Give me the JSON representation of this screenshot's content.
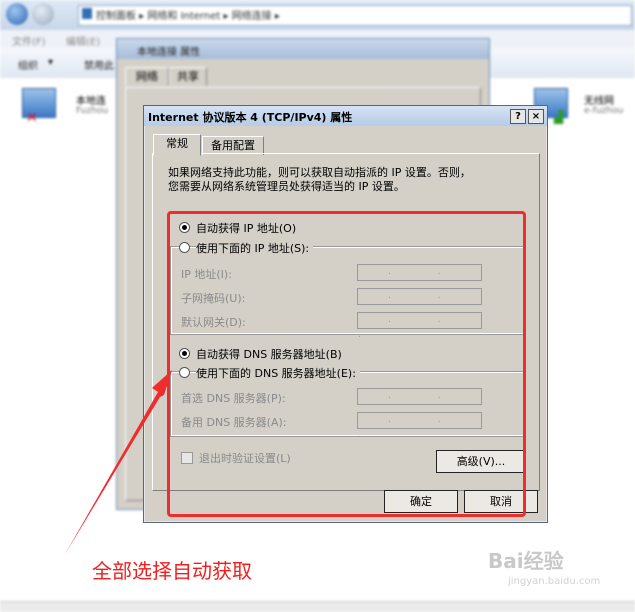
{
  "explorer": {
    "breadcrumb": [
      "控制面板",
      "网络和 Internet",
      "网络连接"
    ],
    "menu": [
      "文件(F)",
      "编辑(E)"
    ],
    "toolbar": [
      "组织",
      "禁用此"
    ],
    "connections": [
      {
        "name": "本地连",
        "detail": "Fuzhou"
      },
      {
        "name": "无线网",
        "detail": "e-fuzhou"
      }
    ]
  },
  "properties_window": {
    "title": "本地连接 属性",
    "tabs": [
      "网络",
      "共享"
    ]
  },
  "dialog": {
    "title": "Internet 协议版本 4 (TCP/IPv4) 属性",
    "help_label": "?",
    "close_label": "×",
    "tabs": [
      "常规",
      "备用配置"
    ],
    "intro_line1": "如果网络支持此功能，则可以获取自动指派的 IP 设置。否则，",
    "intro_line2": "您需要从网络系统管理员处获得适当的 IP 设置。",
    "ip": {
      "auto_label": "自动获得 IP 地址(O)",
      "auto_selected": true,
      "manual_label": "使用下面的 IP 地址(S):",
      "fields": [
        {
          "label": "IP 地址(I):",
          "value": ". . ."
        },
        {
          "label": "子网掩码(U):",
          "value": ". . ."
        },
        {
          "label": "默认网关(D):",
          "value": ". . ."
        }
      ]
    },
    "dns": {
      "auto_label": "自动获得 DNS 服务器地址(B)",
      "auto_selected": true,
      "manual_label": "使用下面的 DNS 服务器地址(E):",
      "fields": [
        {
          "label": "首选 DNS 服务器(P):",
          "value": ". . ."
        },
        {
          "label": "备用 DNS 服务器(A):",
          "value": ". . ."
        }
      ]
    },
    "validate_label": "退出时验证设置(L)",
    "advanced_label": "高级(V)...",
    "ok_label": "确定",
    "cancel_label": "取消"
  },
  "annotation": {
    "text": "全部选择自动获取",
    "color": "#f21e1e"
  },
  "watermark": {
    "brand": "Bai经验",
    "url": "jingyan.baidu.com"
  }
}
